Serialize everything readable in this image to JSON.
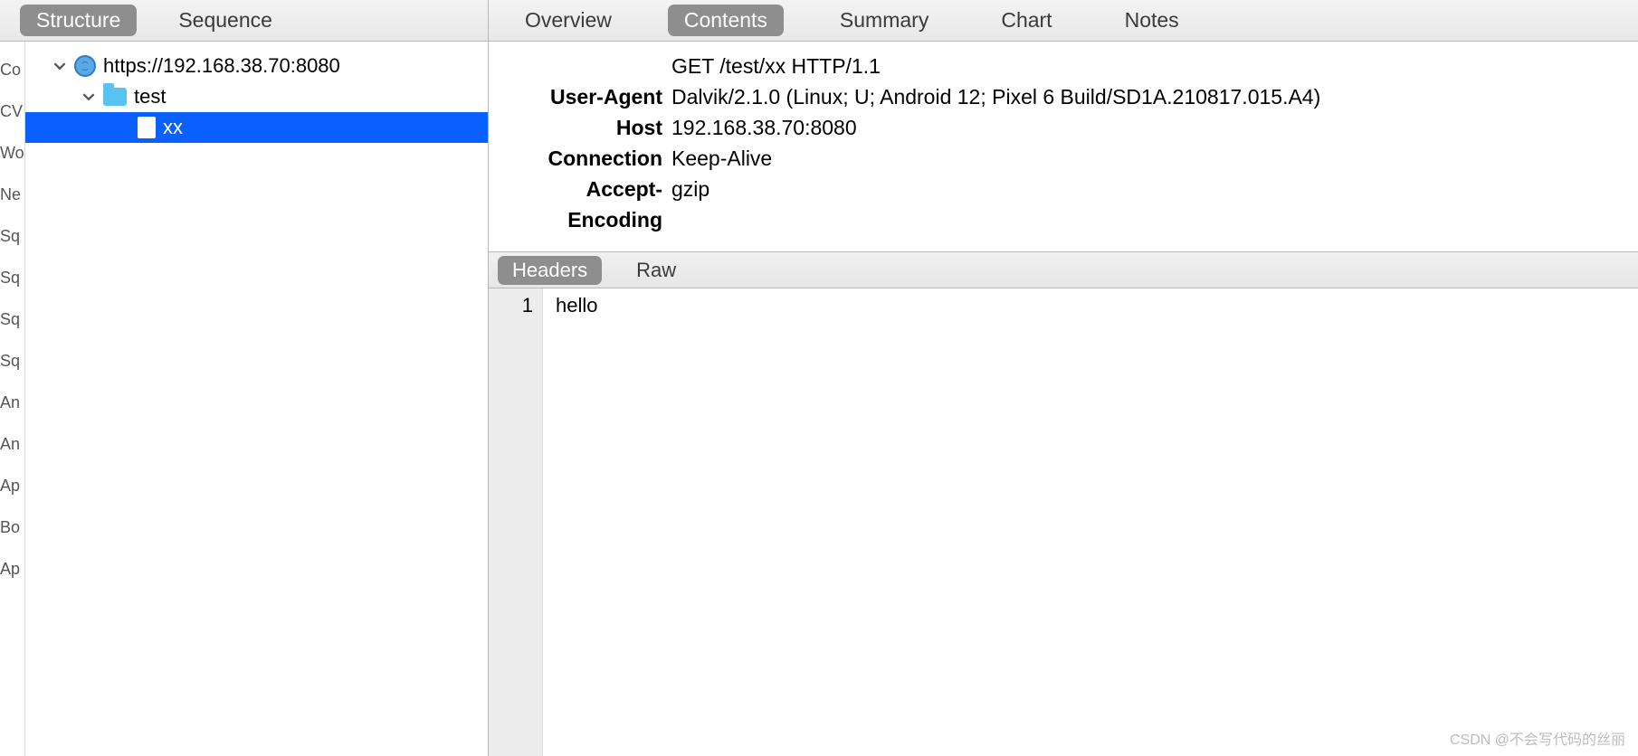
{
  "leftTabs": {
    "structure": "Structure",
    "sequence": "Sequence",
    "active": "structure"
  },
  "rightTabs": {
    "overview": "Overview",
    "contents": "Contents",
    "summary": "Summary",
    "chart": "Chart",
    "notes": "Notes",
    "active": "contents"
  },
  "sideLabels": [
    "Co",
    "CV",
    "Wo",
    "Ne",
    "Sq",
    "Sq",
    "Sq",
    "Sq",
    "An",
    "An",
    "Ap",
    "Bo",
    "Ap"
  ],
  "tree": {
    "root": {
      "label": "https://192.168.38.70:8080"
    },
    "folder": {
      "label": "test"
    },
    "file": {
      "label": "xx"
    }
  },
  "request": {
    "firstLine": "GET /test/xx HTTP/1.1",
    "headers": [
      {
        "k": "User-Agent",
        "v": "Dalvik/2.1.0 (Linux; U; Android 12; Pixel 6 Build/SD1A.210817.015.A4)"
      },
      {
        "k": "Host",
        "v": "192.168.38.70:8080"
      },
      {
        "k": "Connection",
        "v": "Keep-Alive"
      },
      {
        "k": "Accept-Encoding",
        "v": "gzip"
      }
    ]
  },
  "responseTabs": {
    "headers": "Headers",
    "raw": "Raw",
    "active": "headers"
  },
  "responseBody": {
    "line1no": "1",
    "line1": "hello"
  },
  "watermark": "CSDN @不会写代码的丝丽"
}
